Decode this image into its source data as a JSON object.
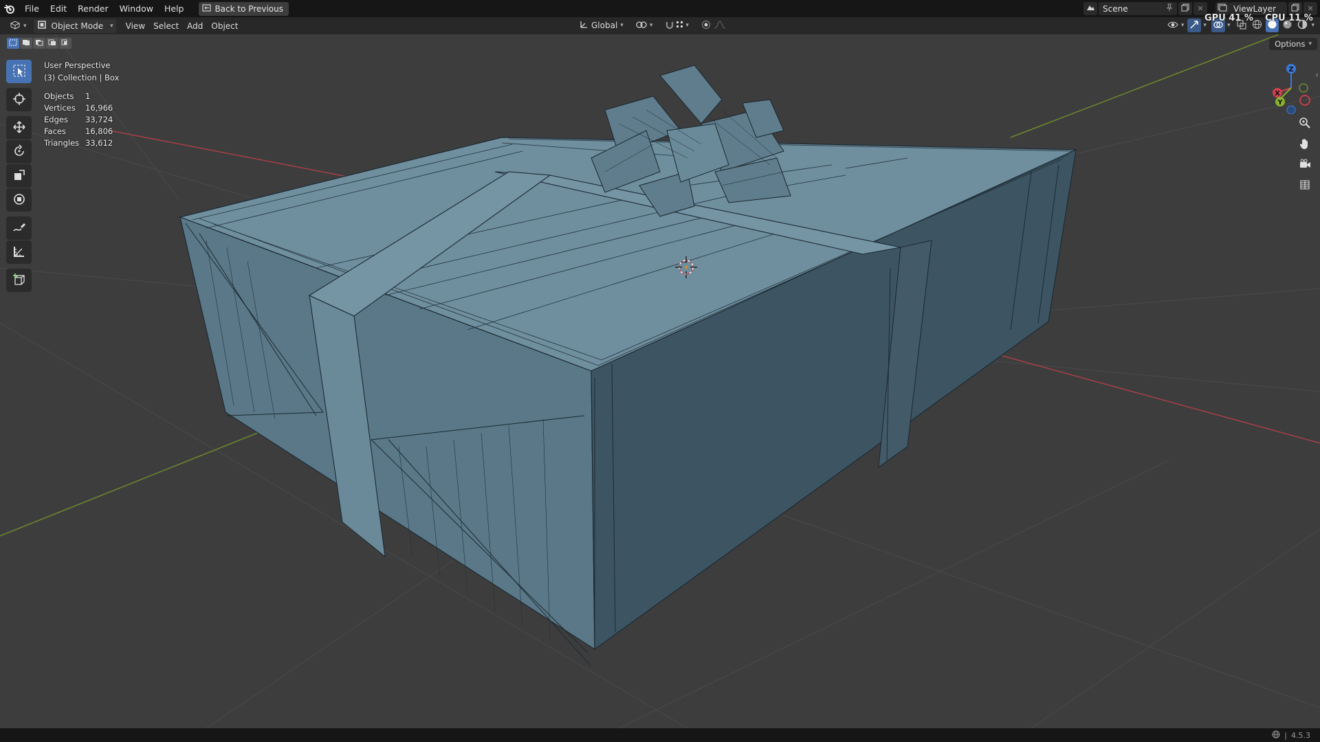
{
  "topbar": {
    "menus": [
      "File",
      "Edit",
      "Render",
      "Window",
      "Help"
    ],
    "back_label": "Back to Previous",
    "scene_label": "Scene",
    "viewlayer_label": "ViewLayer"
  },
  "perf": {
    "gpu": "GPU 41 %",
    "cpu": "CPU 11 %"
  },
  "header": {
    "mode_label": "Object Mode",
    "menus": [
      "View",
      "Select",
      "Add",
      "Object"
    ],
    "transform_orientation": "Global"
  },
  "viewport": {
    "perspective": "User Perspective",
    "collection": "(3) Collection | Box",
    "stats": [
      {
        "label": "Objects",
        "value": "1"
      },
      {
        "label": "Vertices",
        "value": "16,966"
      },
      {
        "label": "Edges",
        "value": "33,724"
      },
      {
        "label": "Faces",
        "value": "16,806"
      },
      {
        "label": "Triangles",
        "value": "33,612"
      }
    ],
    "options_label": "Options",
    "gizmo": {
      "x": "X",
      "y": "Y",
      "z": "Z"
    }
  },
  "tools": [
    {
      "name": "select-box-tool",
      "icon": "cursor-arrow-icon",
      "active": true
    },
    {
      "name": "cursor-tool",
      "icon": "3d-cursor-icon",
      "active": false
    },
    {
      "name": "move-tool",
      "icon": "move-arrows-icon",
      "active": false
    },
    {
      "name": "rotate-tool",
      "icon": "rotate-icon",
      "active": false
    },
    {
      "name": "scale-tool",
      "icon": "scale-icon",
      "active": false
    },
    {
      "name": "transform-tool",
      "icon": "transform-icon",
      "active": false
    },
    {
      "name": "annotate-tool",
      "icon": "annotate-pen-icon",
      "active": false
    },
    {
      "name": "measure-tool",
      "icon": "measure-ruler-icon",
      "active": false
    },
    {
      "name": "add-cube-tool",
      "icon": "add-cube-icon",
      "active": false
    }
  ],
  "statusbar": {
    "version": "4.5.3"
  },
  "colors": {
    "accent": "#4772b3",
    "viewport_bg": "#3d3d3d",
    "mesh_fill": "#5a7a8a",
    "x_axis": "#c83c46",
    "y_axis": "#7a9a28"
  }
}
